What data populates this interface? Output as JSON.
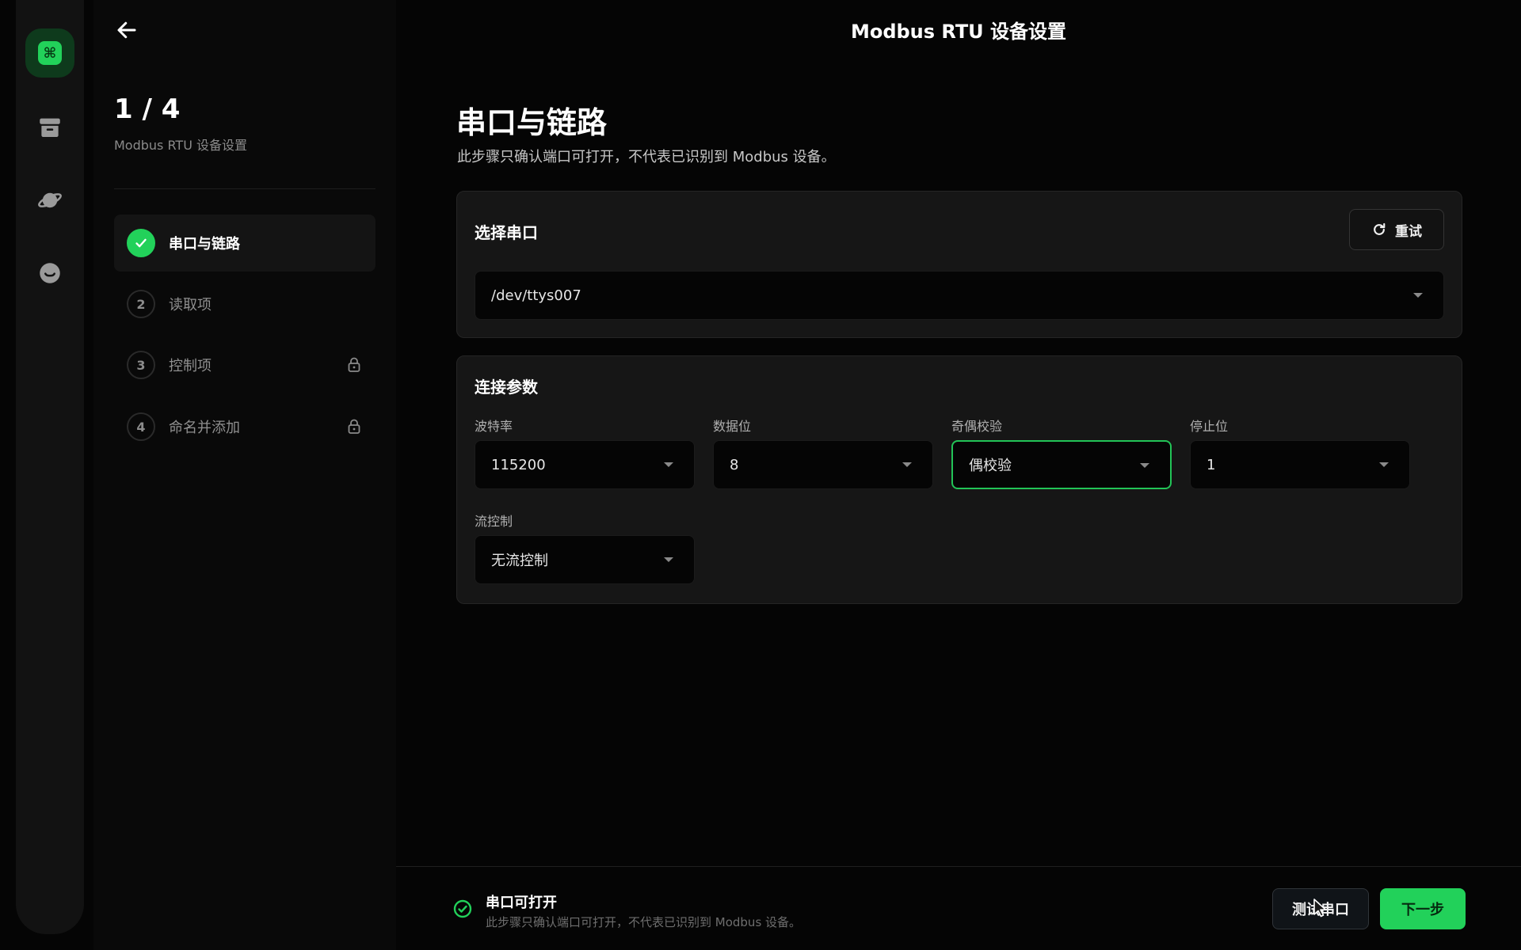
{
  "header": {
    "title": "Modbus RTU 设备设置"
  },
  "rail": {
    "items": [
      {
        "name": "command",
        "glyph": "⌘",
        "active": true
      },
      {
        "name": "archive",
        "active": false
      },
      {
        "name": "planet",
        "active": false
      },
      {
        "name": "smile",
        "active": false
      }
    ]
  },
  "steps": {
    "progress": "1 / 4",
    "subtitle": "Modbus RTU 设备设置",
    "items": [
      {
        "number": "1",
        "label": "串口与链路",
        "state": "done"
      },
      {
        "number": "2",
        "label": "读取项",
        "state": "pending"
      },
      {
        "number": "3",
        "label": "控制项",
        "state": "locked"
      },
      {
        "number": "4",
        "label": "命名并添加",
        "state": "locked"
      }
    ]
  },
  "main": {
    "title": "串口与链路",
    "description": "此步骤只确认端口可打开，不代表已识别到 Modbus 设备。",
    "port_card": {
      "title": "选择串口",
      "retry_label": "重试",
      "selected_port": "/dev/ttys007"
    },
    "params_card": {
      "title": "连接参数",
      "baud": {
        "label": "波特率",
        "value": "115200"
      },
      "data_bits": {
        "label": "数据位",
        "value": "8"
      },
      "parity": {
        "label": "奇偶校验",
        "value": "偶校验"
      },
      "stop_bits": {
        "label": "停止位",
        "value": "1"
      },
      "flow": {
        "label": "流控制",
        "value": "无流控制"
      }
    }
  },
  "footer": {
    "status_title": "串口可打开",
    "status_desc": "此步骤只确认端口可打开，不代表已识别到 Modbus 设备。",
    "test_label": "测试串口",
    "next_label": "下一步"
  },
  "colors": {
    "accent": "#22d15a",
    "background": "#050505",
    "card": "#161616"
  }
}
